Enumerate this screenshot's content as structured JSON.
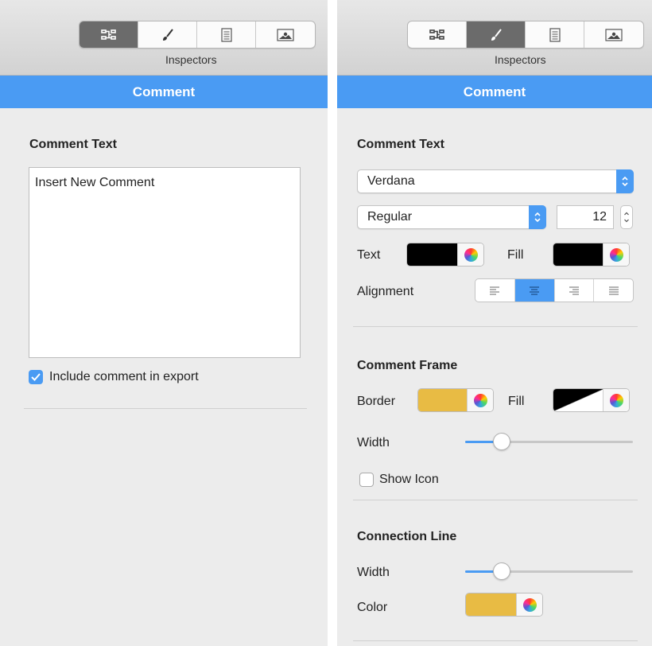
{
  "toolbar": {
    "label": "Inspectors",
    "buttons": [
      {
        "icon": "structure-icon"
      },
      {
        "icon": "brush-icon"
      },
      {
        "icon": "document-icon"
      },
      {
        "icon": "image-icon"
      }
    ]
  },
  "left_panel": {
    "active_tab_index": 0,
    "header": "Comment",
    "section_title": "Comment Text",
    "comment_text": "Insert New Comment",
    "checkbox": {
      "label": "Include comment in export",
      "checked": true
    }
  },
  "right_panel": {
    "active_tab_index": 1,
    "header": "Comment",
    "comment_text_section": {
      "title": "Comment Text",
      "font_family": "Verdana",
      "font_style": "Regular",
      "font_size": "12",
      "text_label": "Text",
      "fill_label": "Fill",
      "text_color": "#000000",
      "fill_color": "#000000",
      "alignment_label": "Alignment",
      "alignment_options": [
        "left",
        "center",
        "right",
        "justify"
      ],
      "alignment_selected": "center"
    },
    "frame_section": {
      "title": "Comment Frame",
      "border_label": "Border",
      "border_color": "#e8bb44",
      "fill_label": "Fill",
      "fill_color": "none",
      "width_label": "Width",
      "width_value": 0.22,
      "show_icon_label": "Show Icon",
      "show_icon_checked": false
    },
    "connection_section": {
      "title": "Connection Line",
      "width_label": "Width",
      "width_value": 0.22,
      "color_label": "Color",
      "color": "#e8bb44"
    }
  },
  "colors": {
    "accent": "#4a9bf3",
    "panel_bg": "#ececec"
  }
}
